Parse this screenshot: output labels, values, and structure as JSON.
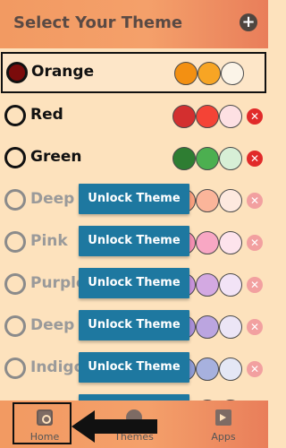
{
  "header": {
    "title": "Select Your Theme",
    "add_label": "+"
  },
  "themes": [
    {
      "name": "Orange",
      "state": "selected",
      "colors": [
        "#f39012",
        "#f7a524",
        "#fbf4e8"
      ],
      "unlock_label": ""
    },
    {
      "name": "Red",
      "state": "unlocked",
      "colors": [
        "#d32f2f",
        "#f44336",
        "#fde0e3"
      ],
      "unlock_label": ""
    },
    {
      "name": "Green",
      "state": "unlocked",
      "colors": [
        "#2e7d32",
        "#4caf50",
        "#d7efd6"
      ],
      "unlock_label": ""
    },
    {
      "name": "Deep O",
      "state": "locked",
      "colors": [
        "#f9a07e",
        "#fbb59a",
        "#fde9df"
      ],
      "unlock_label": "Unlock Theme"
    },
    {
      "name": "Pink",
      "state": "locked",
      "colors": [
        "#f48fb1",
        "#f8a7c4",
        "#fde3ec"
      ],
      "unlock_label": "Unlock Theme"
    },
    {
      "name": "Purple",
      "state": "locked",
      "colors": [
        "#c792da",
        "#d3a9e2",
        "#f2e3f6"
      ],
      "unlock_label": "Unlock Theme"
    },
    {
      "name": "Deep P",
      "state": "locked",
      "colors": [
        "#a98fd8",
        "#bba5e0",
        "#ece5f6"
      ],
      "unlock_label": "Unlock Theme"
    },
    {
      "name": "Indigo",
      "state": "locked",
      "colors": [
        "#8f9bd4",
        "#a7b1de",
        "#e4e7f5"
      ],
      "unlock_label": "Unlock Theme"
    },
    {
      "name": "",
      "state": "locked",
      "colors": [
        "#86b6d9",
        "#a5c9e3",
        "#e0edf6"
      ],
      "unlock_label": ""
    }
  ],
  "delete_glyph": "✕",
  "bottom_nav": {
    "items": [
      {
        "label": "Home",
        "icon": "camera-icon"
      },
      {
        "label": "Themes",
        "icon": "palette-icon"
      },
      {
        "label": "Apps",
        "icon": "store-icon"
      }
    ]
  },
  "colors": {
    "header_gradient": "#f29a62",
    "unlock_button": "#1e78a0",
    "delete_button": "#e12a2a",
    "selected_radio": "#7b0b0b"
  }
}
